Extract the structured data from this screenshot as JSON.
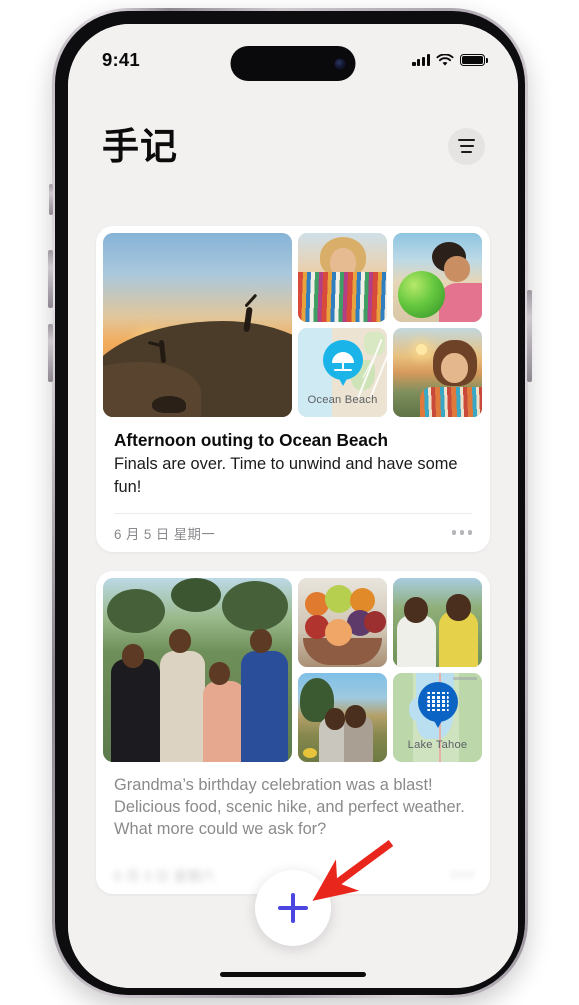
{
  "status_bar": {
    "time": "9:41",
    "cellular_icon": "signal-bars-icon",
    "wifi_icon": "wifi-icon",
    "battery_icon": "battery-full-icon"
  },
  "header": {
    "title": "手记",
    "filter_button_icon": "filter-sort-icon"
  },
  "entries": [
    {
      "title": "Afternoon outing to Ocean Beach",
      "body": "Finals are over. Time to unwind and have some fun!",
      "date": "6 月 5 日 星期一",
      "more_icon": "more-options-icon",
      "photos": [
        {
          "name": "sunset-dunes-photo",
          "kind": "photo"
        },
        {
          "name": "curly-hair-striped-shirt-photo",
          "kind": "photo"
        },
        {
          "name": "green-beach-ball-photo",
          "kind": "photo"
        },
        {
          "name": "ocean-beach-map-tile",
          "kind": "map",
          "label": "Ocean Beach",
          "pin_icon": "beach-umbrella-pin-icon"
        },
        {
          "name": "scarf-sunset-portrait-photo",
          "kind": "photo"
        }
      ]
    },
    {
      "title": "",
      "body": "Grandma’s birthday celebration was a blast! Delicious food, scenic hike, and perfect weather. What more could we ask for?",
      "date": "6 月 3 日 星期六",
      "more_icon": "more-options-icon",
      "photos": [
        {
          "name": "family-group-photo",
          "kind": "photo"
        },
        {
          "name": "fruit-bowl-photo",
          "kind": "photo"
        },
        {
          "name": "two-people-portrait-photo",
          "kind": "photo"
        },
        {
          "name": "hiking-pair-photo",
          "kind": "photo"
        },
        {
          "name": "lake-tahoe-map-tile",
          "kind": "map",
          "label": "Lake Tahoe",
          "pin_icon": "water-waves-pin-icon"
        }
      ]
    }
  ],
  "fab": {
    "icon": "plus-icon",
    "label": "+"
  },
  "annotation": {
    "arrow_icon": "red-pointer-arrow",
    "color": "#e8261c",
    "points_to": "add-entry-fab"
  },
  "colors": {
    "accent": "#4b46e0",
    "screen_background": "#f3f0f0",
    "card_background": "#ffffff",
    "date_text": "#8a8a8e",
    "ocean_pin": "#1ab4e8",
    "tahoe_pin": "#0b63c4"
  }
}
